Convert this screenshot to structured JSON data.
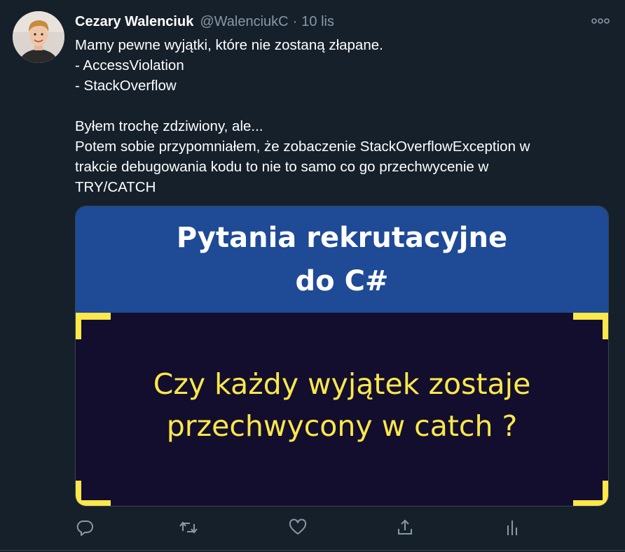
{
  "tweet": {
    "display_name": "Cezary Walenciuk",
    "handle": "@WalenciukC",
    "separator": "·",
    "time": "10 lis",
    "text_lines": [
      "Mamy pewne wyjątki, które nie zostaną złapane.",
      "- AccessViolation",
      "- StackOverflow",
      "",
      "Byłem trochę zdziwiony, ale...",
      "Potem sobie przypomniałem, że zobaczenie StackOverflowException w",
      "trakcie debugowania kodu to nie to samo co go przechwycenie w",
      "TRY/CATCH"
    ]
  },
  "media": {
    "title_line1": "Pytania rekrutacyjne",
    "title_line2": "do C#",
    "question_line1": "Czy każdy wyjątek zostaje",
    "question_line2": "przechwycony w catch ?"
  },
  "icons": {
    "more": "more-horizontal-icon",
    "reply": "reply-icon",
    "retweet": "retweet-icon",
    "like": "like-heart-icon",
    "share": "share-icon",
    "analytics": "analytics-icon"
  },
  "colors": {
    "background": "#15202b",
    "muted_text": "#8899a6",
    "media_banner": "#1e4a96",
    "media_body": "#130e2e",
    "media_accent": "#fde84a"
  }
}
